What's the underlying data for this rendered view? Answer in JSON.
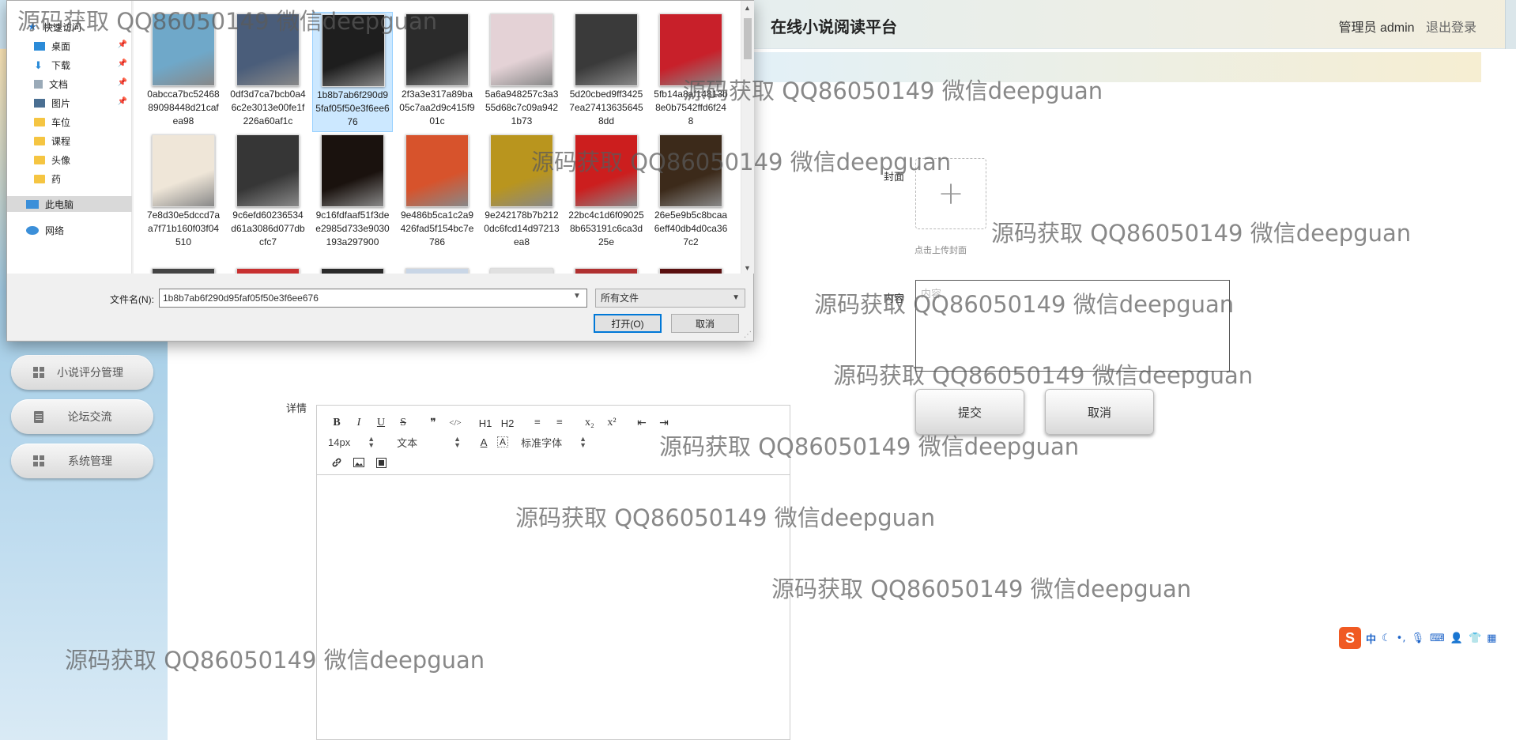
{
  "header": {
    "app_title": "在线小说阅读平台",
    "user_label": "管理员 admin",
    "logout_label": "退出登录"
  },
  "sidebar": {
    "items": [
      {
        "label": "小说评分管理",
        "icon": "grid-icon"
      },
      {
        "label": "论坛交流",
        "icon": "document-icon"
      },
      {
        "label": "系统管理",
        "icon": "grid-icon"
      }
    ]
  },
  "form": {
    "cover_label": "封面",
    "cover_hint": "点击上传封面",
    "content_label": "内容",
    "content_placeholder": "内容",
    "details_label": "详情",
    "submit_label": "提交",
    "cancel_label": "取消"
  },
  "editor": {
    "toolbar_row1": [
      "B",
      "I",
      "U",
      "S",
      "❞",
      "</>",
      "H1",
      "H2",
      "≡",
      "≡",
      "x₂",
      "x²",
      "⇤",
      "⇥"
    ],
    "font_size": "14px",
    "block_type": "文本",
    "font_family": "标准字体",
    "toolbar_row3": [
      "link-icon",
      "image-icon",
      "video-icon"
    ]
  },
  "file_dialog": {
    "nav_items": [
      {
        "label": "快速访问",
        "icon": "star-icon"
      },
      {
        "label": "桌面",
        "icon": "desktop-icon",
        "pinned": true
      },
      {
        "label": "下载",
        "icon": "download-icon",
        "pinned": true
      },
      {
        "label": "文档",
        "icon": "document-icon",
        "pinned": true
      },
      {
        "label": "图片",
        "icon": "picture-icon",
        "pinned": true
      },
      {
        "label": "车位",
        "icon": "folder-icon"
      },
      {
        "label": "课程",
        "icon": "folder-icon"
      },
      {
        "label": "头像",
        "icon": "folder-icon"
      },
      {
        "label": "药",
        "icon": "folder-icon"
      },
      {
        "label": "此电脑",
        "icon": "computer-icon"
      },
      {
        "label": "网络",
        "icon": "network-icon"
      }
    ],
    "files": [
      {
        "name": "0abcca7bc5246889098448d21cafea98",
        "color": "#6fa8c9"
      },
      {
        "name": "0df3d7ca7bcb0a46c2e3013e00fe1f226a60af1c",
        "color": "#4a5d7a"
      },
      {
        "name": "1b8b7ab6f290d95faf05f50e3f6ee676",
        "color": "#1e1e1e",
        "selected": true
      },
      {
        "name": "2f3a3e317a89ba05c7aa2d9c415f901c",
        "color": "#2b2b2b"
      },
      {
        "name": "5a6a948257c3a355d68c7c09a9421b73",
        "color": "#e4d2d6"
      },
      {
        "name": "5d20cbed9ff34257ea274136356458dd",
        "color": "#3a3a3a"
      },
      {
        "name": "5fb14a8af14813b8e0b7542ffd6f248",
        "color": "#c8202a"
      },
      {
        "name": "7e8d30e5dccd7aa7f71b160f03f04510",
        "color": "#efe6d8"
      },
      {
        "name": "9c6efd60236534d61a3086d077dbcfc7",
        "color": "#363636"
      },
      {
        "name": "9c16fdfaaf51f3dee2985d733e9030193a297900",
        "color": "#1a120e"
      },
      {
        "name": "9e486b5ca1c2a9426fad5f154bc7e786",
        "color": "#d7532c"
      },
      {
        "name": "9e242178b7b2120dc6fcd14d97213ea8",
        "color": "#b9951e"
      },
      {
        "name": "22bc4c1d6f090258b653191c6ca3d25e",
        "color": "#cc1e1e"
      },
      {
        "name": "26e5e9b5c8bcaa6eff40db4d0ca367c2",
        "color": "#3c2a1a"
      }
    ],
    "filename_label": "文件名(N):",
    "filename_value": "1b8b7ab6f290d95faf05f50e3f6ee676",
    "filetype_value": "所有文件",
    "open_label": "打开(O)",
    "cancel_label": "取消"
  },
  "ime": {
    "logo": "S",
    "lang": "中"
  },
  "watermark_text": "源码获取 QQ86050149 微信deepguan"
}
